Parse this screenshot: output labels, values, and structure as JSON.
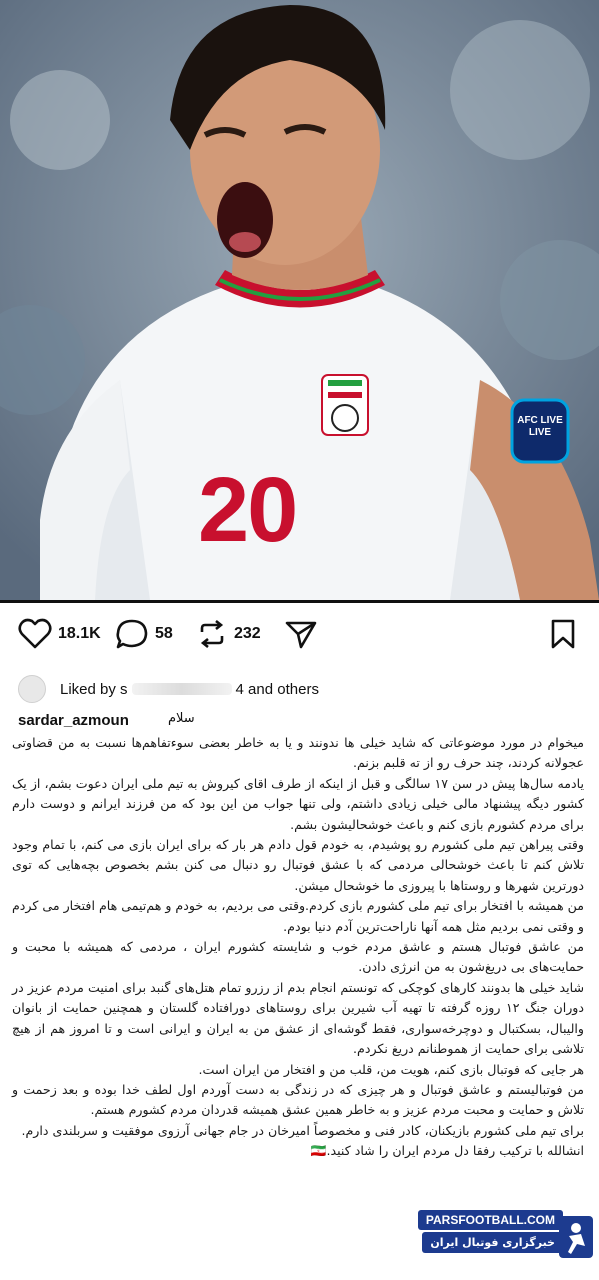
{
  "post": {
    "photo_alt": "",
    "jersey_number": "20",
    "badge_text": "AFC LIVE LIVE"
  },
  "actions": {
    "likes": "18.1K",
    "comments": "58",
    "reposts": "232"
  },
  "liked_by": {
    "prefix": "Liked by s",
    "suffix": "4 and others"
  },
  "caption": {
    "username": "sardar_azmoun",
    "greeting": "سلام",
    "paragraphs": [
      "میخوام در مورد موضوعاتی که شاید خیلی ها ندونند و یا به خاطر بعضی سوءتفاهم‌ها نسبت به من قضاوتی عجولانه کردند، چند حرف رو از ته قلبم بزنم.",
      "یادمه سال‌ها پیش در سن ۱۷ سالگی و قبل از اینکه از طرف اقای کیروش به تیم ملی ایران دعوت بشم، از یک کشور دیگه پیشنهاد مالی خیلی زیادی داشتم، ولی تنها جواب من این بود که من فرزند ایرانم و دوست دارم برای مردم کشورم بازی کنم و باعث خوشحالیشون بشم.",
      "وقتی پیراهن تیم ملی کشورم رو پوشیدم، به خودم قول دادم هر بار که برای ایران بازی می کنم، با تمام وجود تلاش کنم تا باعث خوشحالی مردمی که با عشق فوتبال رو دنبال می کنن بشم بخصوص بچه‌هایی که توی دورترین شهرها و روستاها با پیروزی ما خوشحال میشن.",
      "من همیشه با افتخار برای تیم ملی کشورم بازی کردم.وقتی می بردیم، به خودم و هم‌تیمی هام افتخار می کردم و وقتی نمی بردیم مثل همه آنها ناراحت‌ترین آدم دنیا بودم.",
      "من عاشق فوتبال هستم و عاشق مردم خوب و شایسته کشورم ایران ، مردمی که همیشه با محبت و حمایت‌های بی دریغ‌شون به من انرژی دادن.",
      "شاید خیلی ها بدونند کارهای کوچکی که تونستم انجام بدم از رزرو تمام هتل‌های گنبد برای امنیت مردم عزیز در دوران جنگ ۱۲ روزه گرفته تا تهیه آب شیرین برای روستاهای دورافتاده گلستان و همچنین حمایت از بانوان والیبال، بسکتبال و دوچرخه‌سواری، فقط گوشه‌ای از عشق من به ایران و ایرانی است و تا امروز هم از هیچ تلاشی برای حمایت از هموطنانم دریغ نکردم.",
      "هر جایی که فوتبال بازی کنم، هویت من، قلب من و افتخار من ایران است.",
      "من فوتبالیستم و عاشق فوتبال و هر چیزی که در زندگی به دست آوردم اول لطف خدا بوده و بعد زحمت و تلاش و حمایت و محبت مردم عزیز و به خاطر همین عشق همیشه قدردان مردم کشورم هستم.",
      "برای تیم ملی کشورم بازیکنان، کادر فنی و مخصوصاً امیرخان در جام جهانی آرزوی موفقیت و سربلندی دارم.",
      "انشالله با ترکیب رفقا دل مردم ایران را شاد کنید.🇮🇷"
    ]
  },
  "watermark": {
    "site": "PARSFOOTBALL.COM",
    "name": "خبرگزاری فوتبال ایران"
  },
  "colors": {
    "brand": "#1d3b8f",
    "jersey_number": "#c8102e"
  }
}
